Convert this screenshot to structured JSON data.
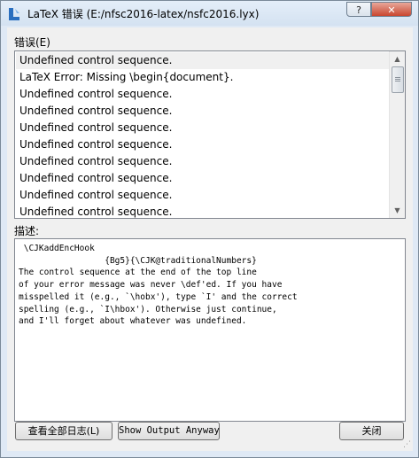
{
  "window": {
    "title": "LaTeX 错误 (E:/nfsc2016-latex/nsfc2016.lyx)",
    "help_label": "?",
    "close_label": "✕"
  },
  "errors": {
    "label": "错误(E)",
    "items": [
      "Undefined control sequence.",
      "LaTeX Error: Missing \\begin{document}.",
      "Undefined control sequence.",
      "Undefined control sequence.",
      "Undefined control sequence.",
      "Undefined control sequence.",
      "Undefined control sequence.",
      "Undefined control sequence.",
      "Undefined control sequence.",
      "Undefined control sequence."
    ]
  },
  "description": {
    "label": "描述:",
    "text": " \\CJKaddEncHook\n                 {Bg5}{\\CJK@traditionalNumbers}\nThe control sequence at the end of the top line\nof your error message was never \\def'ed. If you have\nmisspelled it (e.g., `\\hobx'), type `I' and the correct\nspelling (e.g., `I\\hbox'). Otherwise just continue,\nand I'll forget about whatever was undefined."
  },
  "buttons": {
    "view_log": "查看全部日志(L)",
    "show_output": "Show Output Anyway",
    "close": "关闭"
  }
}
